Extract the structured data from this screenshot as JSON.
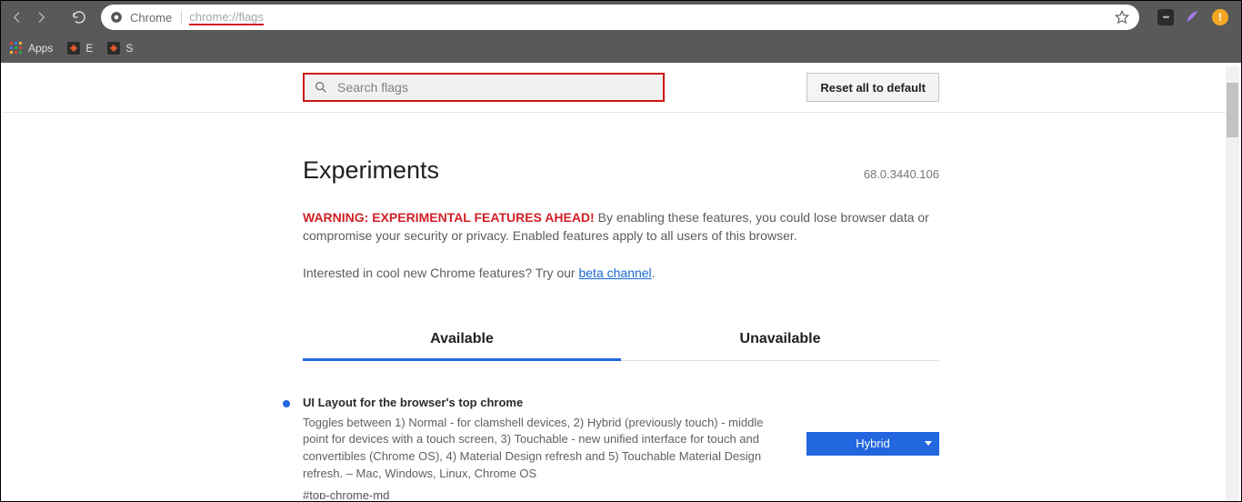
{
  "browser": {
    "omnibox_label": "Chrome",
    "url_prefix": "chrome://",
    "url_emph": "flags",
    "ext_orange_char": "!"
  },
  "bookmarks": {
    "apps": "Apps",
    "e": "E",
    "s": "S"
  },
  "page": {
    "search_placeholder": "Search flags",
    "reset_label": "Reset all to default",
    "heading": "Experiments",
    "version": "68.0.3440.106",
    "warning_prefix": "WARNING: EXPERIMENTAL FEATURES AHEAD!",
    "warning_body": " By enabling these features, you could lose browser data or compromise your security or privacy. Enabled features apply to all users of this browser.",
    "beta_prefix": "Interested in cool new Chrome features? Try our ",
    "beta_link": "beta channel",
    "beta_suffix": ".",
    "tabs": {
      "available": "Available",
      "unavailable": "Unavailable"
    },
    "flag": {
      "title": "UI Layout for the browser's top chrome",
      "desc": "Toggles between 1) Normal - for clamshell devices, 2) Hybrid (previously touch) - middle point for devices with a touch screen, 3) Touchable - new unified interface for touch and convertibles (Chrome OS), 4) Material Design refresh and 5) Touchable Material Design refresh. – Mac, Windows, Linux, Chrome OS",
      "hash": "#top-chrome-md",
      "selected": "Hybrid"
    }
  }
}
